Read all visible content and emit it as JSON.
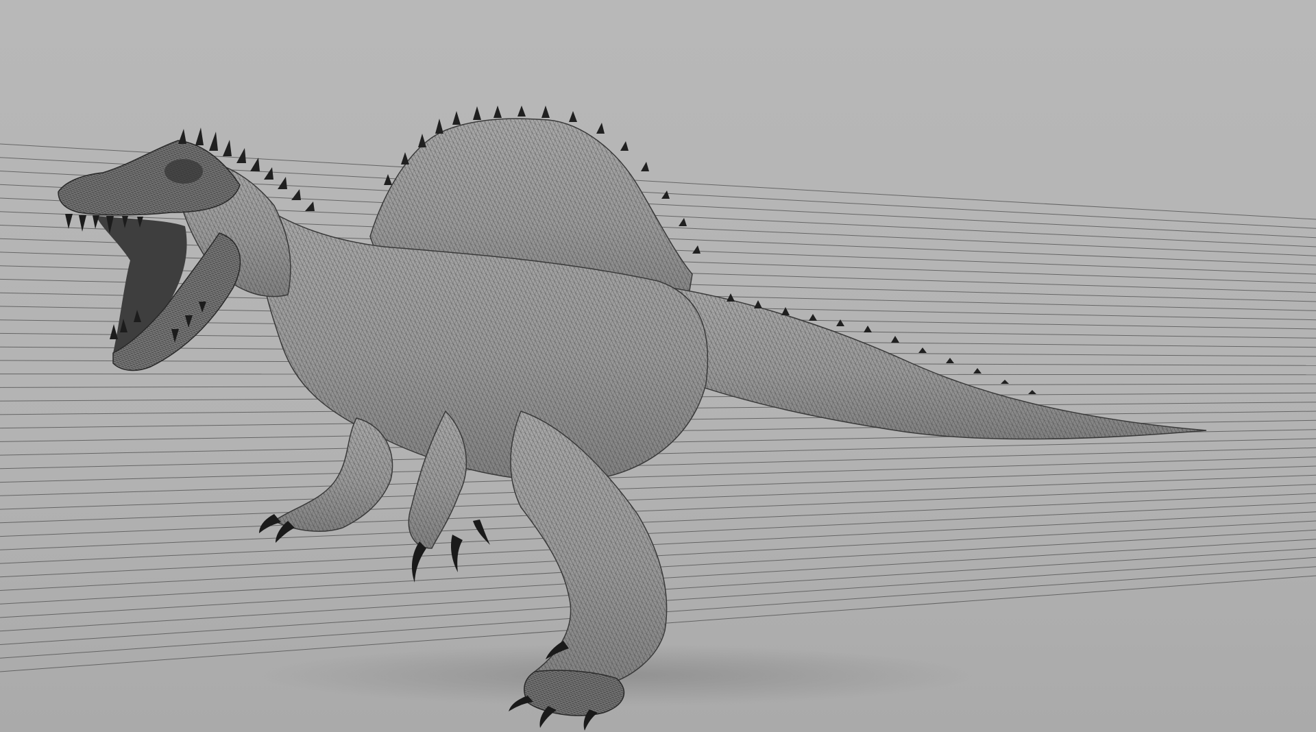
{
  "scene": {
    "subject": "spinosaurus-wireframe-render",
    "colors": {
      "background": "#b4b4b4",
      "backdrop_top": "#b9b9b9",
      "backdrop_bottom": "#a9a9a9",
      "floor": "#afafaf",
      "backdrop_lines": "#4a4a4a",
      "model_fill": "#9d9d9d",
      "model_shadow": "#3b3b3b",
      "wire": "#2f2f2f",
      "spike": "#202020"
    },
    "backdrop_line_count": 40,
    "icons": {
      "dinosaur": "dinosaur-icon",
      "spines": "spine-icon",
      "claws": "claw-icon"
    }
  }
}
